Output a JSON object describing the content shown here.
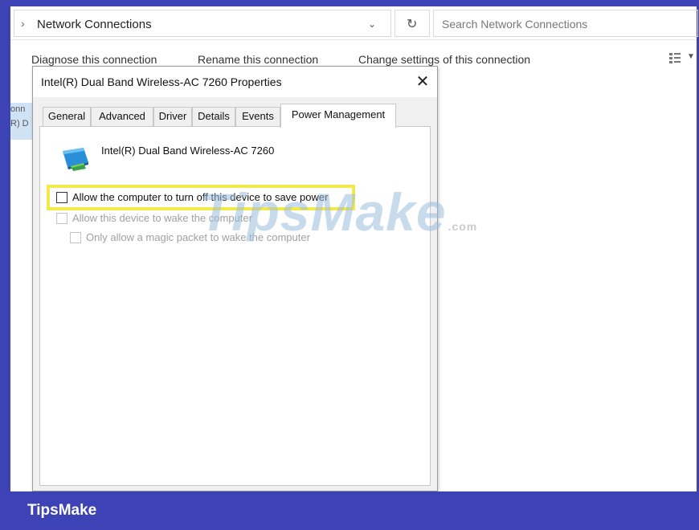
{
  "explorer": {
    "address": "Network Connections",
    "search_placeholder": "Search Network Connections",
    "commands": {
      "diagnose": "Diagnose this connection",
      "rename": "Rename this connection",
      "change_settings": "Change settings of this connection"
    },
    "connection_item": {
      "line1": "onn",
      "line2": "R) D"
    }
  },
  "dialog": {
    "title": "Intel(R) Dual Band Wireless-AC 7260 Properties",
    "tabs": [
      "General",
      "Advanced",
      "Driver",
      "Details",
      "Events",
      "Power Management"
    ],
    "active_tab": "Power Management",
    "device_name": "Intel(R) Dual Band Wireless-AC 7260",
    "options": [
      {
        "label": "Allow the computer to turn off this device to save power",
        "checked": false,
        "enabled": true
      },
      {
        "label": "Allow this device to wake the computer",
        "checked": false,
        "enabled": false
      },
      {
        "label": "Only allow a magic packet to wake the computer",
        "checked": false,
        "enabled": false
      }
    ]
  },
  "watermark": {
    "text": "TipsMake",
    "domain": ".com"
  },
  "footer": {
    "brand": "TipsMake"
  },
  "colors": {
    "frame": "#3d42b5",
    "highlight": "#f3e94a",
    "selection": "#cfe3f5"
  },
  "icons": {
    "address_chevron": "›",
    "dropdown": "⌄",
    "refresh": "↻",
    "close": "✕"
  }
}
